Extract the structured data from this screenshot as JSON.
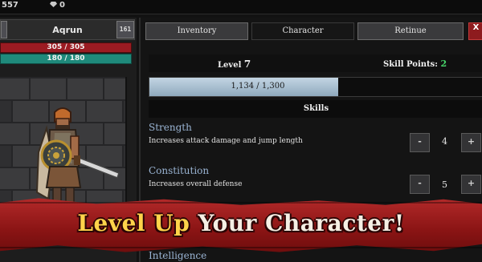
{
  "top": {
    "gold": "557",
    "gems": "0"
  },
  "character": {
    "name": "Aqrun",
    "badge": "161",
    "hp": "305 / 305",
    "mp": "180 / 180"
  },
  "tabs": [
    {
      "label": "Inventory"
    },
    {
      "label": "Character"
    },
    {
      "label": "Retinue"
    },
    {
      "label": "X"
    }
  ],
  "level": {
    "label": "Level",
    "value": "7"
  },
  "skill_points": {
    "label": "Skill Points:",
    "value": "2"
  },
  "xp": {
    "text": "1,134 / 1,300",
    "fraction": 0.87
  },
  "skills_header": "Skills",
  "skills": [
    {
      "name": "Strength",
      "description": "Increases attack damage and jump length",
      "value": "4",
      "minus": "-",
      "plus": "+"
    },
    {
      "name": "Constitution",
      "description": "Increases overall defense",
      "value": "5",
      "minus": "-",
      "plus": "+"
    },
    {
      "name": "Intelligence"
    }
  ],
  "banner": {
    "part1": "Level Up",
    "part2": " Your Character!"
  },
  "colors": {
    "hp": "#9b1b22",
    "mp": "#1f8a7b",
    "accent_green": "#47d46a",
    "skill_name": "#9ab4d3",
    "banner_red": "#8a1414",
    "banner_gold": "#ffd34a"
  }
}
